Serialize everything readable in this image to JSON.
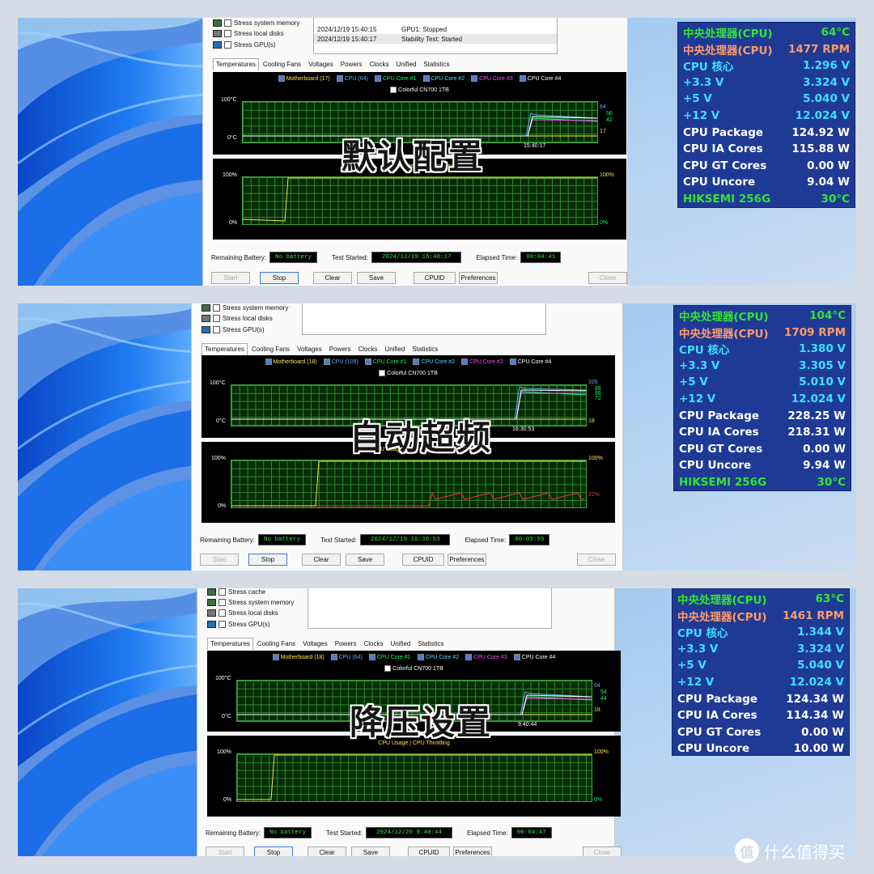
{
  "colors": {
    "temp_green": "#33e433",
    "fan_orange": "#ff9b6a",
    "cyan": "#3fe0ff",
    "white": "#ffffff",
    "panel_bg": "#1f3a95",
    "series_motherboard": "#ffe14a",
    "series_cpu": "#5ab0ff",
    "series_core1": "#00ff66",
    "series_core2": "#4ae0ff",
    "series_core3": "#ff4aff",
    "series_core4": "#ffffff",
    "usage_yellow": "#ffe14a",
    "throttle_red": "#ff3030"
  },
  "sections": [
    {
      "overlay": "默认配置",
      "stress_opts": [
        "Stress system memory",
        "Stress local disks",
        "Stress GPU(s)"
      ],
      "log": [
        {
          "time": "2024/12/19 15:40:15",
          "event": "GPU1: Stopped"
        },
        {
          "time": "2024/12/19 15:40:17",
          "event": "Stability Test: Started"
        }
      ],
      "tabs": [
        "Temperatures",
        "Cooling Fans",
        "Voltages",
        "Powers",
        "Clocks",
        "Unified",
        "Statistics"
      ],
      "legend": [
        "Motherboard (17)",
        "CPU (64)",
        "CPU Core #1",
        "CPU Core #2",
        "CPU Core #3",
        "CPU Core #4"
      ],
      "legend2": "Colorful CN700 1TB",
      "temp_axis": {
        "top": "100°C",
        "bottom": "0°C"
      },
      "temp_right": [
        "64",
        "56",
        "42",
        "17"
      ],
      "temp_time": "15:40:17",
      "usage_title": "CPU Usage | CPU Throttling",
      "usage_axis": {
        "top": "100%",
        "bottom": "0%"
      },
      "usage_right": {
        "top": "100%",
        "bottom": "0%"
      },
      "status": {
        "battery_label": "Remaining Battery:",
        "battery": "No battery",
        "started_label": "Test Started:",
        "started": "2024/12/19 15:40:17",
        "elapsed_label": "Elapsed Time:",
        "elapsed": "00:04:41"
      },
      "buttons": [
        "Start",
        "Stop",
        "Clear",
        "Save",
        "CPUID",
        "Preferences",
        "Close"
      ],
      "hw": [
        {
          "label": "中央处理器(CPU)",
          "value": "64°C",
          "color": "temp_green"
        },
        {
          "label": "中央处理器(CPU)",
          "value": "1477 RPM",
          "color": "fan_orange"
        },
        {
          "label": "CPU 核心",
          "value": "1.296 V",
          "color": "cyan"
        },
        {
          "label": "+3.3 V",
          "value": "3.324 V",
          "color": "cyan"
        },
        {
          "label": "+5 V",
          "value": "5.040 V",
          "color": "cyan"
        },
        {
          "label": "+12 V",
          "value": "12.024 V",
          "color": "cyan"
        },
        {
          "label": "CPU Package",
          "value": "124.92 W",
          "color": "white"
        },
        {
          "label": "CPU IA Cores",
          "value": "115.88 W",
          "color": "white"
        },
        {
          "label": "CPU GT Cores",
          "value": "0.00 W",
          "color": "white"
        },
        {
          "label": "CPU Uncore",
          "value": "9.04 W",
          "color": "white"
        },
        {
          "label": "HIKSEMI 256G",
          "value": "30°C",
          "color": "temp_green"
        }
      ]
    },
    {
      "overlay": "自动超频",
      "stress_opts": [
        "Stress system memory",
        "Stress local disks",
        "Stress GPU(s)"
      ],
      "log": [],
      "tabs": [
        "Temperatures",
        "Cooling Fans",
        "Voltages",
        "Powers",
        "Clocks",
        "Unified",
        "Statistics"
      ],
      "legend": [
        "Motherboard (18)",
        "CPU (105)",
        "CPU Core #1",
        "CPU Core #2",
        "CPU Core #3",
        "CPU Core #4"
      ],
      "legend2": "Colorful CN700 1TB",
      "temp_axis": {
        "top": "100°C",
        "bottom": "0°C"
      },
      "temp_right": [
        "105",
        "88",
        "88",
        "72",
        "18"
      ],
      "temp_time": "16:30:53",
      "usage_title": "CPU Usage | CPU Throttling",
      "usage_axis": {
        "top": "100%",
        "bottom": "0%"
      },
      "usage_right": {
        "top": "100%",
        "bottom": "22%"
      },
      "status": {
        "battery_label": "Remaining Battery:",
        "battery": "No battery",
        "started_label": "Test Started:",
        "started": "2024/12/19 16:30:53",
        "elapsed_label": "Elapsed Time:",
        "elapsed": "00:03:59"
      },
      "buttons": [
        "Start",
        "Stop",
        "Clear",
        "Save",
        "CPUID",
        "Preferences",
        "Close"
      ],
      "hw": [
        {
          "label": "中央处理器(CPU)",
          "value": "104°C",
          "color": "temp_green"
        },
        {
          "label": "中央处理器(CPU)",
          "value": "1709 RPM",
          "color": "fan_orange"
        },
        {
          "label": "CPU 核心",
          "value": "1.380 V",
          "color": "cyan"
        },
        {
          "label": "+3.3 V",
          "value": "3.305 V",
          "color": "cyan"
        },
        {
          "label": "+5 V",
          "value": "5.010 V",
          "color": "cyan"
        },
        {
          "label": "+12 V",
          "value": "12.024 V",
          "color": "cyan"
        },
        {
          "label": "CPU Package",
          "value": "228.25 W",
          "color": "white"
        },
        {
          "label": "CPU IA Cores",
          "value": "218.31 W",
          "color": "white"
        },
        {
          "label": "CPU GT Cores",
          "value": "0.00 W",
          "color": "white"
        },
        {
          "label": "CPU Uncore",
          "value": "9.94 W",
          "color": "white"
        },
        {
          "label": "HIKSEMI 256G",
          "value": "30°C",
          "color": "temp_green"
        }
      ]
    },
    {
      "overlay": "降压设置",
      "stress_opts": [
        "Stress cache",
        "Stress system memory",
        "Stress local disks",
        "Stress GPU(s)"
      ],
      "log": [],
      "tabs": [
        "Temperatures",
        "Cooling Fans",
        "Voltages",
        "Powers",
        "Clocks",
        "Unified",
        "Statistics"
      ],
      "legend": [
        "Motherboard (18)",
        "CPU (64)",
        "CPU Core #1",
        "CPU Core #2",
        "CPU Core #3",
        "CPU Core #4"
      ],
      "legend2": "Colorful CN700 1TB",
      "temp_axis": {
        "top": "100°C",
        "bottom": "0°C"
      },
      "temp_right": [
        "64",
        "54",
        "44",
        "18"
      ],
      "temp_time": "9:40:44",
      "usage_title": "CPU Usage | CPU Throttling",
      "usage_axis": {
        "top": "100%",
        "bottom": "0%"
      },
      "usage_right": {
        "top": "100%",
        "bottom": "0%"
      },
      "status": {
        "battery_label": "Remaining Battery:",
        "battery": "No battery",
        "started_label": "Test Started:",
        "started": "2024/12/20 9:40:44",
        "elapsed_label": "Elapsed Time:",
        "elapsed": "00:04:47"
      },
      "buttons": [
        "Start",
        "Stop",
        "Clear",
        "Save",
        "CPUID",
        "Preferences",
        "Close"
      ],
      "hw": [
        {
          "label": "中央处理器(CPU)",
          "value": "63°C",
          "color": "temp_green"
        },
        {
          "label": "中央处理器(CPU)",
          "value": "1461 RPM",
          "color": "fan_orange"
        },
        {
          "label": "CPU 核心",
          "value": "1.344 V",
          "color": "cyan"
        },
        {
          "label": "+3.3 V",
          "value": "3.324 V",
          "color": "cyan"
        },
        {
          "label": "+5 V",
          "value": "5.040 V",
          "color": "cyan"
        },
        {
          "label": "+12 V",
          "value": "12.024 V",
          "color": "cyan"
        },
        {
          "label": "CPU Package",
          "value": "124.34 W",
          "color": "white"
        },
        {
          "label": "CPU IA Cores",
          "value": "114.34 W",
          "color": "white"
        },
        {
          "label": "CPU GT Cores",
          "value": "0.00 W",
          "color": "white"
        },
        {
          "label": "CPU Uncore",
          "value": "10.00 W",
          "color": "white"
        }
      ]
    }
  ],
  "watermark": {
    "logo": "值",
    "text": "什么值得买"
  }
}
